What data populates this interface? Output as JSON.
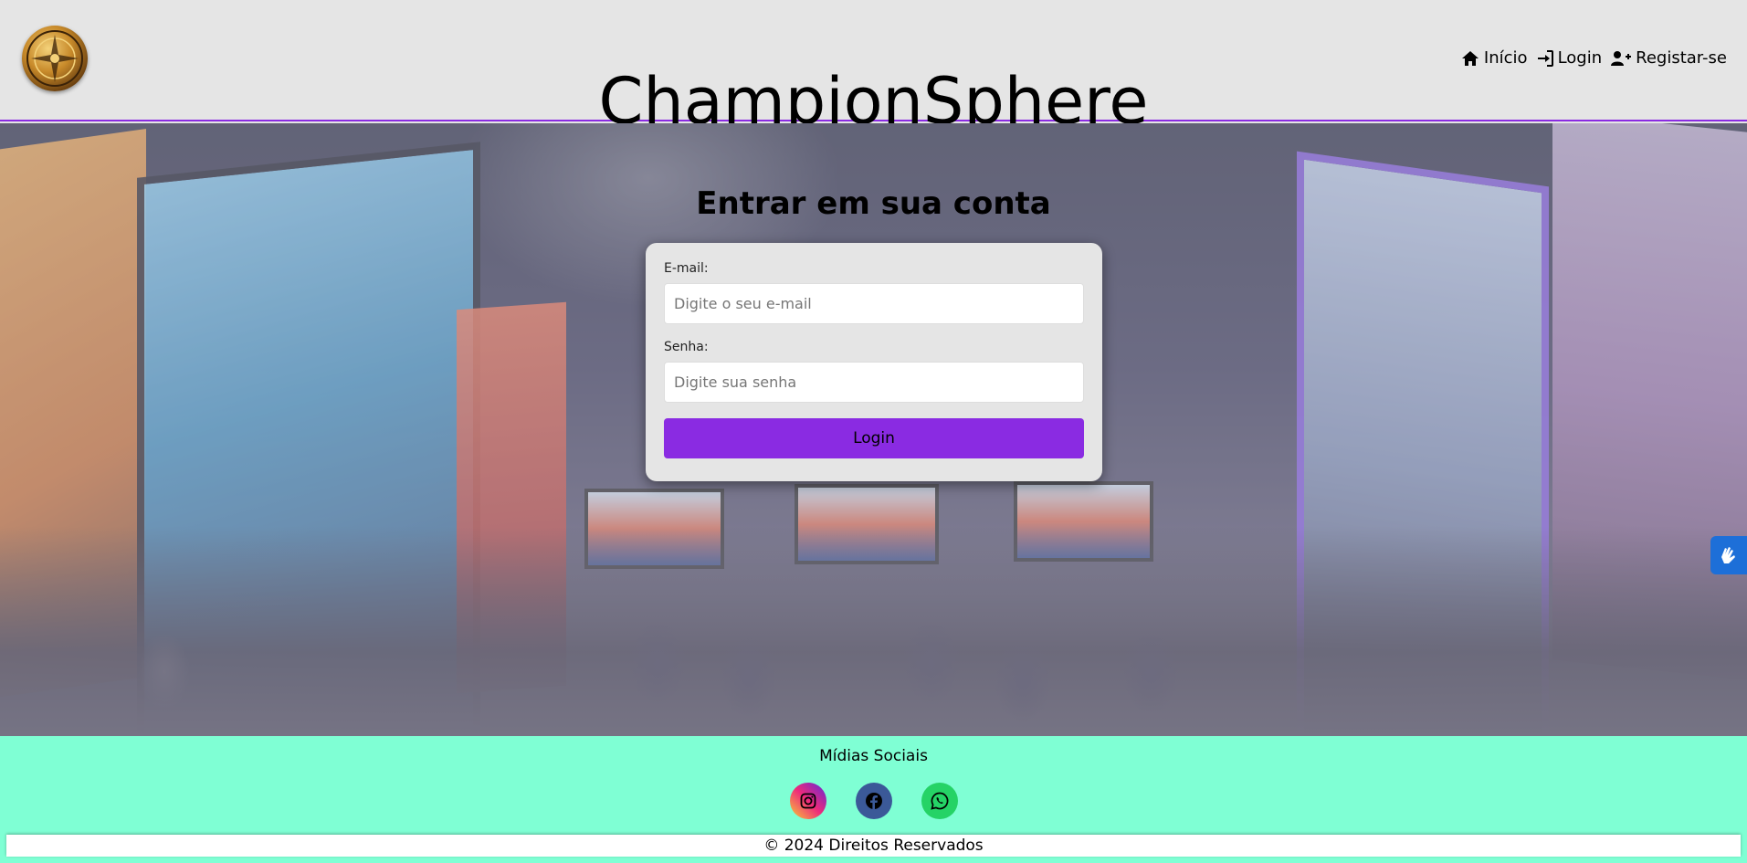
{
  "header": {
    "title": "ChampionSphere",
    "logo_icon": "compass-emblem-icon",
    "nav": [
      {
        "label": "Início",
        "icon": "home-icon"
      },
      {
        "label": "Login",
        "icon": "sign-in-icon"
      },
      {
        "label": "Registar-se",
        "icon": "user-plus-icon"
      }
    ]
  },
  "login": {
    "title": "Entrar em sua conta",
    "email_label": "E-mail:",
    "email_placeholder": "Digite o seu e-mail",
    "email_value": "",
    "password_label": "Senha:",
    "password_placeholder": "Digite sua senha",
    "password_value": "",
    "submit_label": "Login"
  },
  "footer": {
    "social_title": "Mídias Sociais",
    "social": [
      {
        "name": "instagram",
        "icon": "instagram-icon"
      },
      {
        "name": "facebook",
        "icon": "facebook-icon"
      },
      {
        "name": "whatsapp",
        "icon": "whatsapp-icon"
      }
    ],
    "copyright": "© 2024 Direitos Reservados"
  },
  "colors": {
    "accent": "#8a2be2",
    "footer_bg": "#7fffd4",
    "header_bg": "#e5e5e5",
    "a11y_widget": "#1d6fd8"
  }
}
